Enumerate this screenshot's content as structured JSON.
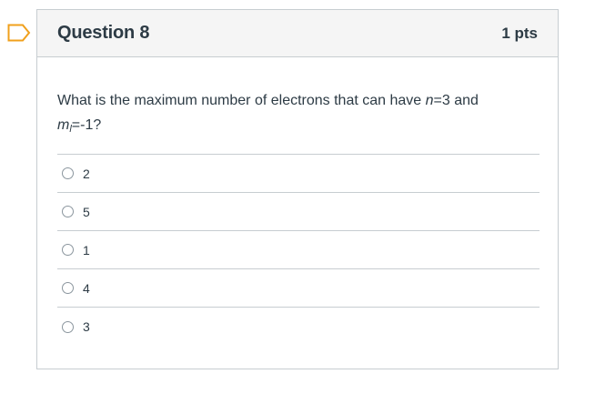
{
  "question": {
    "title": "Question 8",
    "points": "1 pts",
    "text_line1": "What is the maximum number of electrons that can have ",
    "n_symbol": "n",
    "n_value": "=3 and",
    "m_symbol": "m",
    "m_subscript": "l",
    "m_value": "=-1?"
  },
  "answers": [
    {
      "label": "2"
    },
    {
      "label": "5"
    },
    {
      "label": "1"
    },
    {
      "label": "4"
    },
    {
      "label": "3"
    }
  ],
  "colors": {
    "flag": "#f0a01c",
    "text": "#2d3b45",
    "border": "#c7cdd1",
    "header_bg": "#f5f5f5"
  },
  "icons": {
    "flag": "bookmark-flag-icon"
  }
}
